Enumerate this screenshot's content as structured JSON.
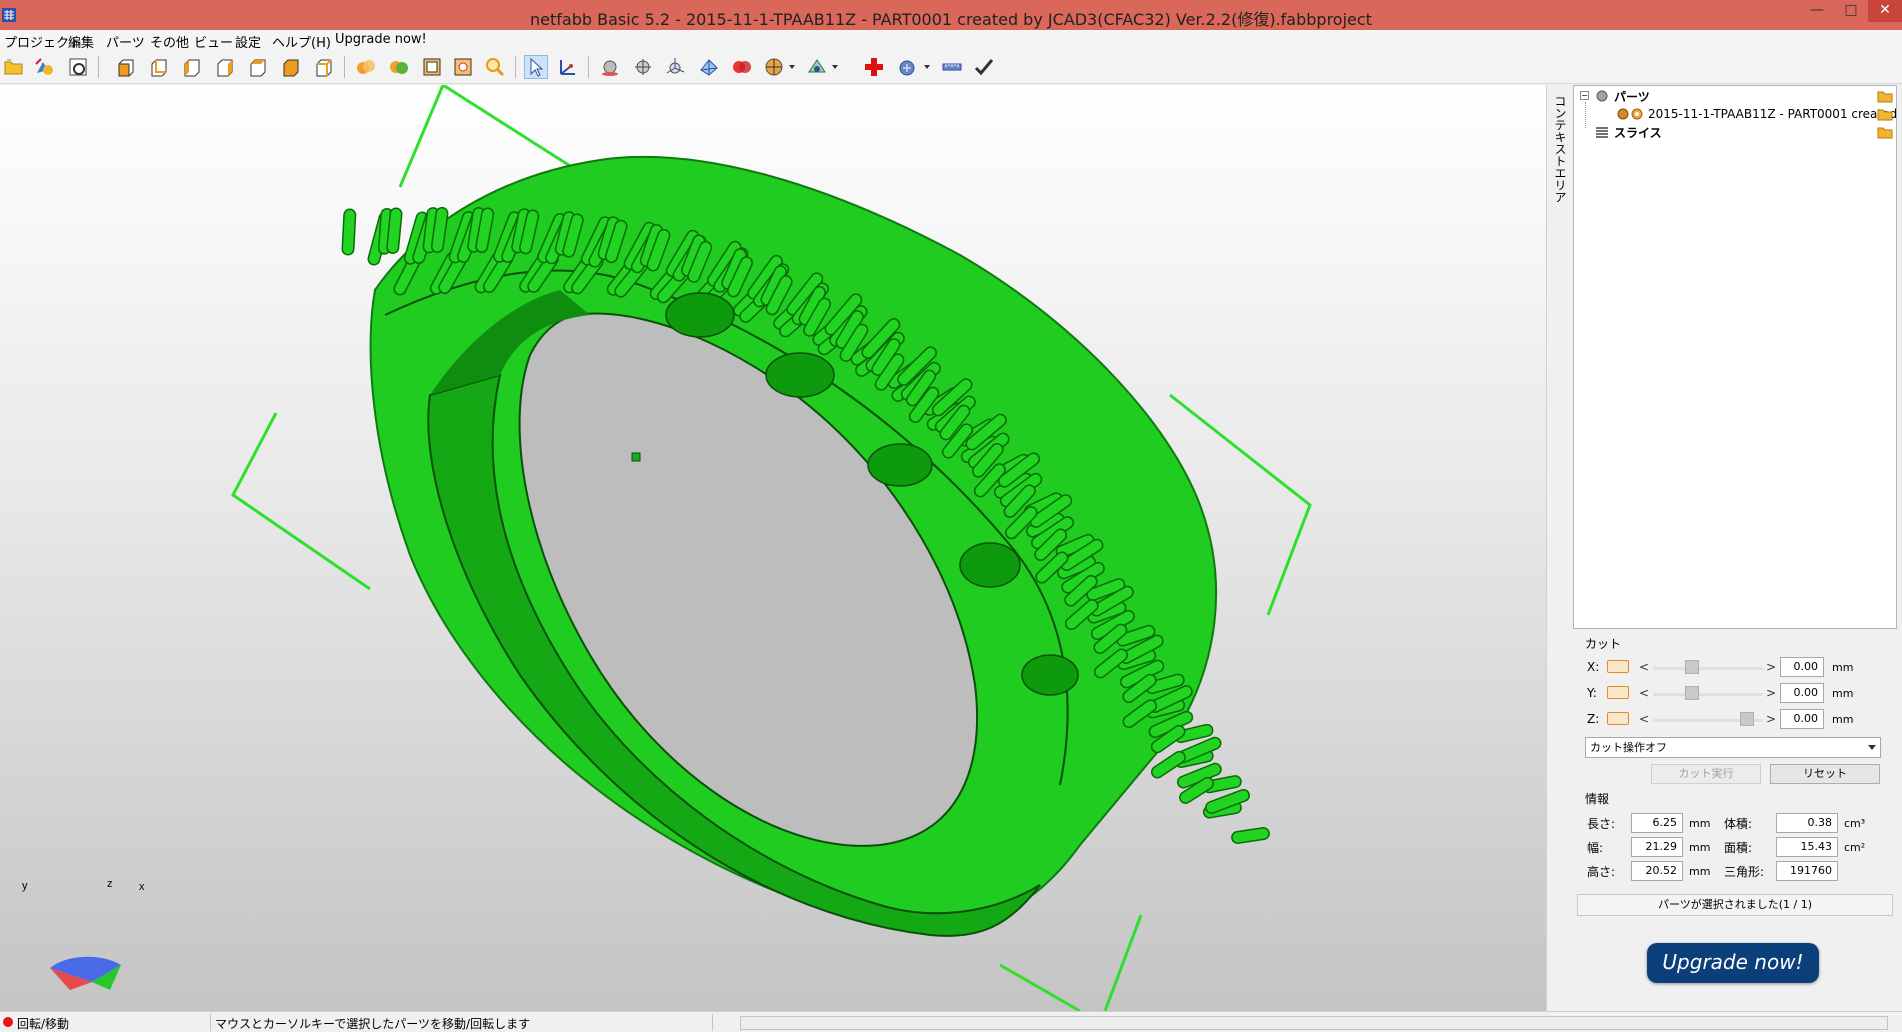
{
  "window": {
    "title": "netfabb Basic 5.2 - 2015-11-1-TPAAB11Z - PART0001 created by JCAD3(CFAC32) Ver.2.2(修復).fabbproject",
    "controls": [
      "—",
      "□",
      "✕"
    ]
  },
  "menu": [
    "プロジェクト",
    "編集",
    "パーツ",
    "その他",
    "ビュー",
    "設定",
    "ヘルプ(H)",
    "Upgrade now!"
  ],
  "toolbar": {
    "icons": [
      "open-folder-icon",
      "add-part-icon",
      "export-icon",
      "view-front-icon",
      "view-back-icon",
      "view-left-icon",
      "view-right-icon",
      "view-top-icon",
      "view-bottom-icon",
      "view-iso-icon",
      "color-parts-icon",
      "color-layers-icon",
      "wireframe-icon",
      "zoom-selection-icon",
      "zoom-icon",
      "select-pointer-icon",
      "measure-icon",
      "sphere-icon",
      "sphere-move-icon",
      "axis-icon",
      "mesh-icon",
      "boolean-icon",
      "slice-icon",
      "analysis-icon",
      "add-repair-icon",
      "repair-icon",
      "ruler-icon",
      "apply-check-icon"
    ]
  },
  "viewport": {
    "colors": {
      "part": "#1fcc1f",
      "part_dark": "#0d8a0d",
      "bbox": "#2ee02e"
    },
    "axes": {
      "x": "x",
      "y": "y",
      "z": "z"
    }
  },
  "context_strip": {
    "label": "コンテキストエリア"
  },
  "tree": {
    "root_label": "パーツ",
    "part_label": "2015-11-1-TPAAB11Z - PART0001 created",
    "slice_label": "スライス"
  },
  "cut": {
    "title": "カット",
    "axes": [
      {
        "label": "X:",
        "value": "0.00",
        "unit": "mm",
        "position": 0.35
      },
      {
        "label": "Y:",
        "value": "0.00",
        "unit": "mm",
        "position": 0.35
      },
      {
        "label": "Z:",
        "value": "0.00",
        "unit": "mm",
        "position": 0.85
      }
    ],
    "mode": "カット操作オフ",
    "execute_label": "カット実行",
    "reset_label": "リセット",
    "arrow_left": "<",
    "arrow_right": ">"
  },
  "info": {
    "title": "情報",
    "length_label": "長さ:",
    "length": "6.25",
    "length_unit": "mm",
    "width_label": "幅:",
    "width": "21.29",
    "width_unit": "mm",
    "height_label": "高さ:",
    "height": "20.52",
    "height_unit": "mm",
    "volume_label": "体積:",
    "volume": "0.38",
    "volume_unit": "cm³",
    "area_label": "面積:",
    "area": "15.43",
    "area_unit": "cm²",
    "triangles_label": "三角形:",
    "triangles": "191760",
    "selection_status": "パーツが選択されました(1 / 1)"
  },
  "upgrade_button": "Upgrade now!",
  "statusbar": {
    "mode": "回転/移動",
    "hint": "マウスとカーソルキーで選択したパーツを移動/回転します"
  }
}
